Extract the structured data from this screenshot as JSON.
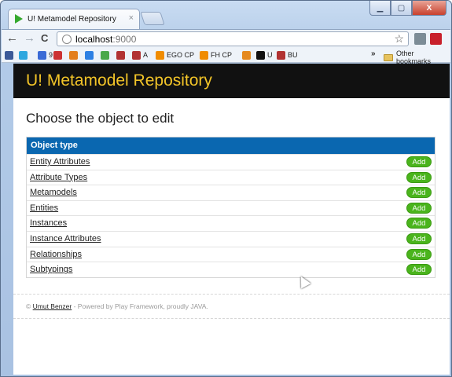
{
  "browser": {
    "tab_title": "U! Metamodel Repository",
    "tab_close": "×",
    "url_host": "localhost",
    "url_port": ":9000",
    "nav": {
      "back": "←",
      "forward": "→",
      "reload": "C"
    },
    "star": "☆",
    "window_controls": {
      "minimize": "▁",
      "maximize": "▢",
      "close": "X"
    },
    "bookmarks": [
      {
        "label": "",
        "color": "#3b5998"
      },
      {
        "label": "",
        "color": "#2fa7df"
      },
      {
        "label": "9",
        "color": "#3b6bd6"
      },
      {
        "label": "",
        "color": "#cc3333"
      },
      {
        "label": "",
        "color": "#e37f1d"
      },
      {
        "label": "",
        "color": "#2d80e3"
      },
      {
        "label": "",
        "color": "#4aa84a"
      },
      {
        "label": "",
        "color": "#b13232"
      },
      {
        "label": "A",
        "color": "#b13232"
      },
      {
        "label": "EGO CP",
        "color": "#f08c00"
      },
      {
        "label": "FH CP",
        "color": "#f08c00"
      },
      {
        "label": "",
        "color": "#e58a1f"
      },
      {
        "label": "U",
        "color": "#111111"
      },
      {
        "label": "BU",
        "color": "#b13232"
      }
    ],
    "more_bookmarks": "»",
    "other_bookmarks": "Other bookmarks"
  },
  "page": {
    "app_title": "U! Metamodel Repository",
    "heading": "Choose the object to edit",
    "table": {
      "header": "Object type",
      "add_label": "Add",
      "rows": [
        "Entity Attributes",
        "Attribute Types",
        "Metamodels",
        "Entities",
        "Instances",
        "Instance Attributes",
        "Relationships",
        "Subtypings"
      ]
    },
    "footer": {
      "copyright": "©",
      "author": "Umut Benzer",
      "text": " - Powered by Play Framework, proudly JAVA."
    }
  },
  "colors": {
    "header_bg": "#111111",
    "title_color": "#f2c428",
    "table_header_bg": "#0a67b0",
    "add_button_bg": "#4ab41c"
  }
}
